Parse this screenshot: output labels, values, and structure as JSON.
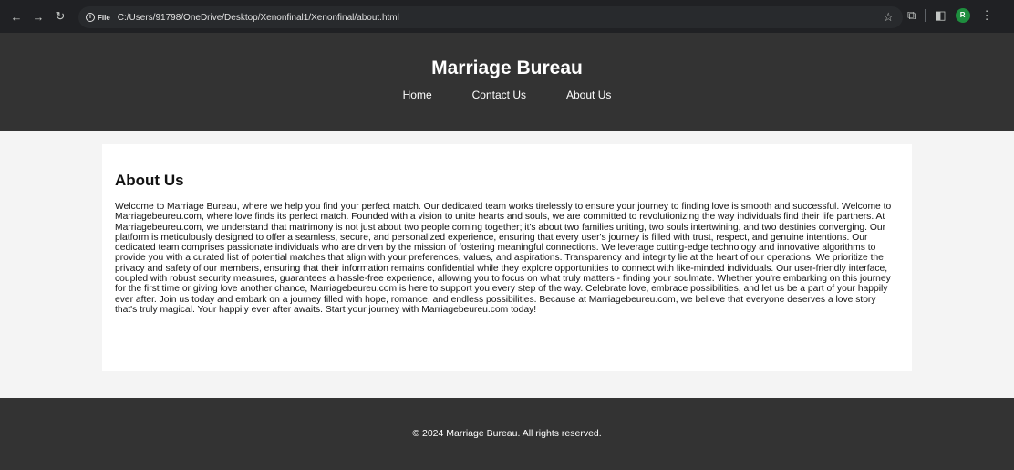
{
  "browser": {
    "site_chip_label": "File",
    "info_glyph": "i",
    "url": "C:/Users/91798/OneDrive/Desktop/Xenonfinal1/Xenonfinal/about.html",
    "profile_initial": "R",
    "icons": {
      "back": "←",
      "forward": "→",
      "reload": "↻",
      "star": "☆",
      "extensions": "⧉",
      "side_panel": "◧",
      "menu": "⋮"
    }
  },
  "header": {
    "title": "Marriage Bureau",
    "nav": [
      "Home",
      "Contact Us",
      "About Us"
    ]
  },
  "main": {
    "heading": "About Us",
    "body": "Welcome to Marriage Bureau, where we help you find your perfect match. Our dedicated team works tirelessly to ensure your journey to finding love is smooth and successful. Welcome to Marriagebeureu.com, where love finds its perfect match. Founded with a vision to unite hearts and souls, we are committed to revolutionizing the way individuals find their life partners. At Marriagebeureu.com, we understand that matrimony is not just about two people coming together; it's about two families uniting, two souls intertwining, and two destinies converging. Our platform is meticulously designed to offer a seamless, secure, and personalized experience, ensuring that every user's journey is filled with trust, respect, and genuine intentions. Our dedicated team comprises passionate individuals who are driven by the mission of fostering meaningful connections. We leverage cutting-edge technology and innovative algorithms to provide you with a curated list of potential matches that align with your preferences, values, and aspirations. Transparency and integrity lie at the heart of our operations. We prioritize the privacy and safety of our members, ensuring that their information remains confidential while they explore opportunities to connect with like-minded individuals. Our user-friendly interface, coupled with robust security measures, guarantees a hassle-free experience, allowing you to focus on what truly matters - finding your soulmate. Whether you're embarking on this journey for the first time or giving love another chance, Marriagebeureu.com is here to support you every step of the way. Celebrate love, embrace possibilities, and let us be a part of your happily ever after. Join us today and embark on a journey filled with hope, romance, and endless possibilities. Because at Marriagebeureu.com, we believe that everyone deserves a love story that's truly magical. Your happily ever after awaits. Start your journey with Marriagebeureu.com today!"
  },
  "footer": {
    "text": "© 2024 Marriage Bureau. All rights reserved."
  },
  "colors": {
    "header_bg": "#333333",
    "page_bg": "#f4f4f4",
    "card_bg": "#ffffff",
    "browser_bg": "#202124"
  }
}
